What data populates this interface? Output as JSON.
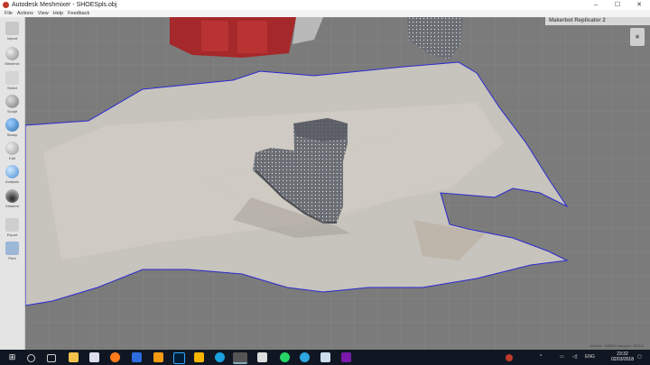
{
  "window": {
    "title": "Autodesk Meshmixer - SHOESpls.obj",
    "controls": [
      "–",
      "☐",
      "✕"
    ]
  },
  "menu": [
    "File",
    "Actions",
    "View",
    "Help",
    "Feedback"
  ],
  "tools": [
    {
      "label": "Import",
      "icon": "plus-icon"
    },
    {
      "label": "Meshmix",
      "icon": "sphere-icon"
    },
    {
      "label": "Select",
      "icon": "brush-icon"
    },
    {
      "label": "Sculpt",
      "icon": "sculpt-icon"
    },
    {
      "label": "Stamp",
      "icon": "stamp-icon"
    },
    {
      "label": "Edit",
      "icon": "edit-icon"
    },
    {
      "label": "Analysis",
      "icon": "analysis-icon"
    },
    {
      "label": "Shaders",
      "icon": "shader-icon"
    },
    {
      "label": "Export",
      "icon": "export-icon"
    },
    {
      "label": "Print",
      "icon": "print-icon"
    }
  ],
  "viewport": {
    "printer": "Makerbot Replicator 2",
    "stats": "vertices: 186693 triangles: 361161"
  },
  "taskbar": {
    "apps": [
      "windows-icon",
      "search-icon",
      "taskview-icon",
      "explorer-icon",
      "store-icon",
      "firefox-icon",
      "files-icon",
      "vlc-icon",
      "photoshop-icon",
      "illustrator-icon",
      "ccleaner-icon",
      "meshmixer-icon",
      "calculator-icon",
      "whatsapp-icon",
      "telegram-icon",
      "notes-icon",
      "onenote-icon"
    ],
    "lang": "ENG",
    "time": "23:32",
    "date": "02/03/2018"
  }
}
